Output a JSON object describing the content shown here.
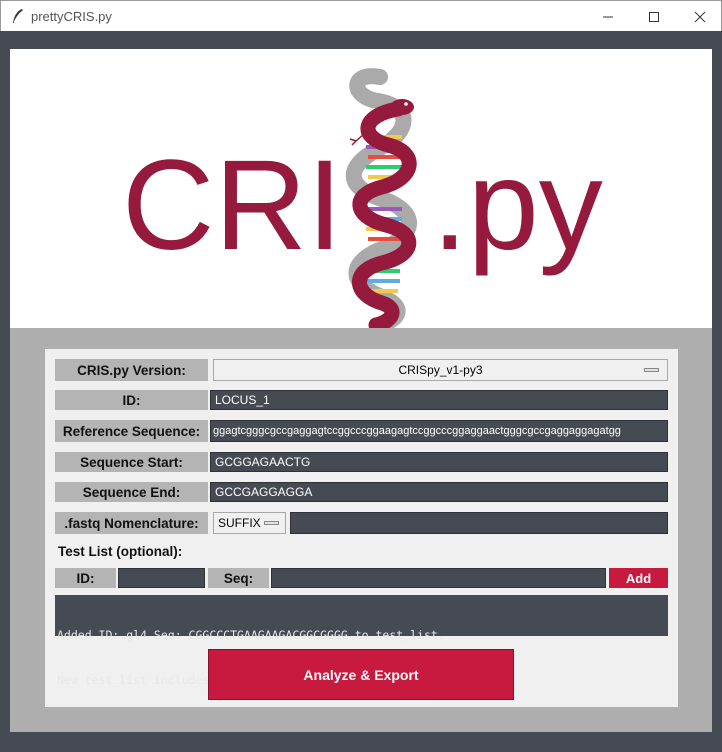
{
  "window": {
    "title": "prettyCRIS.py",
    "minimize_glyph": "—",
    "maximize_glyph": "☐",
    "close_glyph": "✕"
  },
  "logo": {
    "text_left": "CRI",
    "text_right": ".py",
    "brand_color": "#951a3d",
    "icon": "dna-snake-logo-icon"
  },
  "form": {
    "version_label": "CRIS.py Version:",
    "version_value": "CRISpy_v1-py3",
    "id_label": "ID:",
    "id_value": "LOCUS_1",
    "ref_label": "Reference Sequence:",
    "ref_value": "ggagtcgggcgccgaggagtccggcccggaagagtccggcccggaggaactgggcgccgaggaggagatgg",
    "start_label": "Sequence Start:",
    "start_value": "GCGGAGAACTG",
    "end_label": "Sequence End:",
    "end_value": "GCCGAGGAGGA",
    "fastq_label": ".fastq Nomenclature:",
    "fastq_option": "SUFFIX",
    "fastq_value": "",
    "testlist_title": "Test List (optional):",
    "test_id_label": "ID:",
    "test_id_value": "",
    "test_seq_label": "Seq:",
    "test_seq_value": "",
    "add_label": "Add",
    "log_line1": "Added ID: gl4 Seq: CGGCCCTGAAGAAGACGGCGGGG to test_list.",
    "log_line2": "New test_list includes IDs: gl0 gl4",
    "analyze_label": "Analyze & Export"
  },
  "colors": {
    "accent": "#c8193f",
    "field_bg": "#464b53",
    "label_bg": "#b4b4b4"
  }
}
